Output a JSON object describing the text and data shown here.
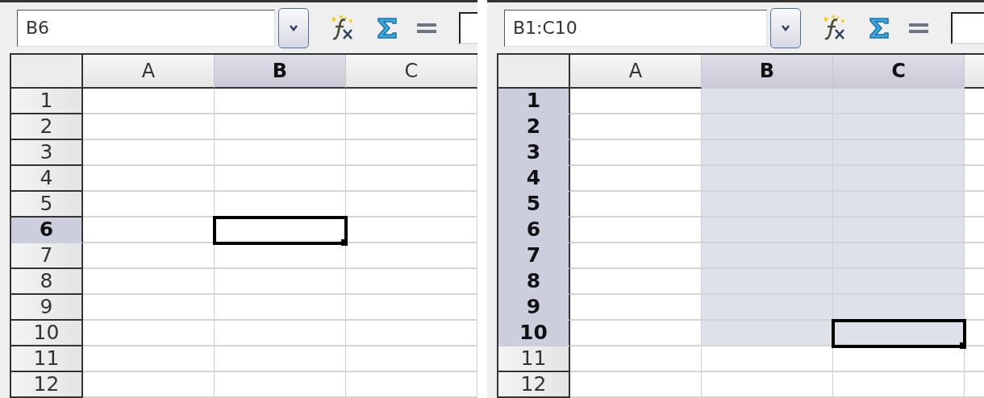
{
  "panels": [
    {
      "name_box": "B6",
      "columns": [
        {
          "label": "A",
          "selected": false
        },
        {
          "label": "B",
          "selected": true
        },
        {
          "label": "C",
          "selected": false
        }
      ],
      "rows": [
        {
          "label": "1",
          "selected": false,
          "cells": [
            {
              "selected": false,
              "cursor": false
            },
            {
              "selected": false,
              "cursor": false
            },
            {
              "selected": false,
              "cursor": false
            }
          ]
        },
        {
          "label": "2",
          "selected": false,
          "cells": [
            {
              "selected": false,
              "cursor": false
            },
            {
              "selected": false,
              "cursor": false
            },
            {
              "selected": false,
              "cursor": false
            }
          ]
        },
        {
          "label": "3",
          "selected": false,
          "cells": [
            {
              "selected": false,
              "cursor": false
            },
            {
              "selected": false,
              "cursor": false
            },
            {
              "selected": false,
              "cursor": false
            }
          ]
        },
        {
          "label": "4",
          "selected": false,
          "cells": [
            {
              "selected": false,
              "cursor": false
            },
            {
              "selected": false,
              "cursor": false
            },
            {
              "selected": false,
              "cursor": false
            }
          ]
        },
        {
          "label": "5",
          "selected": false,
          "cells": [
            {
              "selected": false,
              "cursor": false
            },
            {
              "selected": false,
              "cursor": false
            },
            {
              "selected": false,
              "cursor": false
            }
          ]
        },
        {
          "label": "6",
          "selected": true,
          "cells": [
            {
              "selected": false,
              "cursor": false
            },
            {
              "selected": false,
              "cursor": true
            },
            {
              "selected": false,
              "cursor": false
            }
          ]
        },
        {
          "label": "7",
          "selected": false,
          "cells": [
            {
              "selected": false,
              "cursor": false
            },
            {
              "selected": false,
              "cursor": false
            },
            {
              "selected": false,
              "cursor": false
            }
          ]
        },
        {
          "label": "8",
          "selected": false,
          "cells": [
            {
              "selected": false,
              "cursor": false
            },
            {
              "selected": false,
              "cursor": false
            },
            {
              "selected": false,
              "cursor": false
            }
          ]
        },
        {
          "label": "9",
          "selected": false,
          "cells": [
            {
              "selected": false,
              "cursor": false
            },
            {
              "selected": false,
              "cursor": false
            },
            {
              "selected": false,
              "cursor": false
            }
          ]
        },
        {
          "label": "10",
          "selected": false,
          "cells": [
            {
              "selected": false,
              "cursor": false
            },
            {
              "selected": false,
              "cursor": false
            },
            {
              "selected": false,
              "cursor": false
            }
          ]
        },
        {
          "label": "11",
          "selected": false,
          "cells": [
            {
              "selected": false,
              "cursor": false
            },
            {
              "selected": false,
              "cursor": false
            },
            {
              "selected": false,
              "cursor": false
            }
          ]
        },
        {
          "label": "12",
          "selected": false,
          "cells": [
            {
              "selected": false,
              "cursor": false
            },
            {
              "selected": false,
              "cursor": false
            },
            {
              "selected": false,
              "cursor": false
            }
          ]
        }
      ]
    },
    {
      "name_box": "B1:C10",
      "columns": [
        {
          "label": "A",
          "selected": false
        },
        {
          "label": "B",
          "selected": true
        },
        {
          "label": "C",
          "selected": true
        }
      ],
      "rows": [
        {
          "label": "1",
          "selected": true,
          "cells": [
            {
              "selected": false,
              "cursor": false
            },
            {
              "selected": true,
              "cursor": false
            },
            {
              "selected": true,
              "cursor": false
            }
          ]
        },
        {
          "label": "2",
          "selected": true,
          "cells": [
            {
              "selected": false,
              "cursor": false
            },
            {
              "selected": true,
              "cursor": false
            },
            {
              "selected": true,
              "cursor": false
            }
          ]
        },
        {
          "label": "3",
          "selected": true,
          "cells": [
            {
              "selected": false,
              "cursor": false
            },
            {
              "selected": true,
              "cursor": false
            },
            {
              "selected": true,
              "cursor": false
            }
          ]
        },
        {
          "label": "4",
          "selected": true,
          "cells": [
            {
              "selected": false,
              "cursor": false
            },
            {
              "selected": true,
              "cursor": false
            },
            {
              "selected": true,
              "cursor": false
            }
          ]
        },
        {
          "label": "5",
          "selected": true,
          "cells": [
            {
              "selected": false,
              "cursor": false
            },
            {
              "selected": true,
              "cursor": false
            },
            {
              "selected": true,
              "cursor": false
            }
          ]
        },
        {
          "label": "6",
          "selected": true,
          "cells": [
            {
              "selected": false,
              "cursor": false
            },
            {
              "selected": true,
              "cursor": false
            },
            {
              "selected": true,
              "cursor": false
            }
          ]
        },
        {
          "label": "7",
          "selected": true,
          "cells": [
            {
              "selected": false,
              "cursor": false
            },
            {
              "selected": true,
              "cursor": false
            },
            {
              "selected": true,
              "cursor": false
            }
          ]
        },
        {
          "label": "8",
          "selected": true,
          "cells": [
            {
              "selected": false,
              "cursor": false
            },
            {
              "selected": true,
              "cursor": false
            },
            {
              "selected": true,
              "cursor": false
            }
          ]
        },
        {
          "label": "9",
          "selected": true,
          "cells": [
            {
              "selected": false,
              "cursor": false
            },
            {
              "selected": true,
              "cursor": false
            },
            {
              "selected": true,
              "cursor": false
            }
          ]
        },
        {
          "label": "10",
          "selected": true,
          "cells": [
            {
              "selected": false,
              "cursor": false
            },
            {
              "selected": true,
              "cursor": false
            },
            {
              "selected": true,
              "cursor": true
            }
          ]
        },
        {
          "label": "11",
          "selected": false,
          "cells": [
            {
              "selected": false,
              "cursor": false
            },
            {
              "selected": false,
              "cursor": false
            },
            {
              "selected": false,
              "cursor": false
            }
          ]
        },
        {
          "label": "12",
          "selected": false,
          "cells": [
            {
              "selected": false,
              "cursor": false
            },
            {
              "selected": false,
              "cursor": false
            },
            {
              "selected": false,
              "cursor": false
            }
          ]
        }
      ]
    }
  ]
}
